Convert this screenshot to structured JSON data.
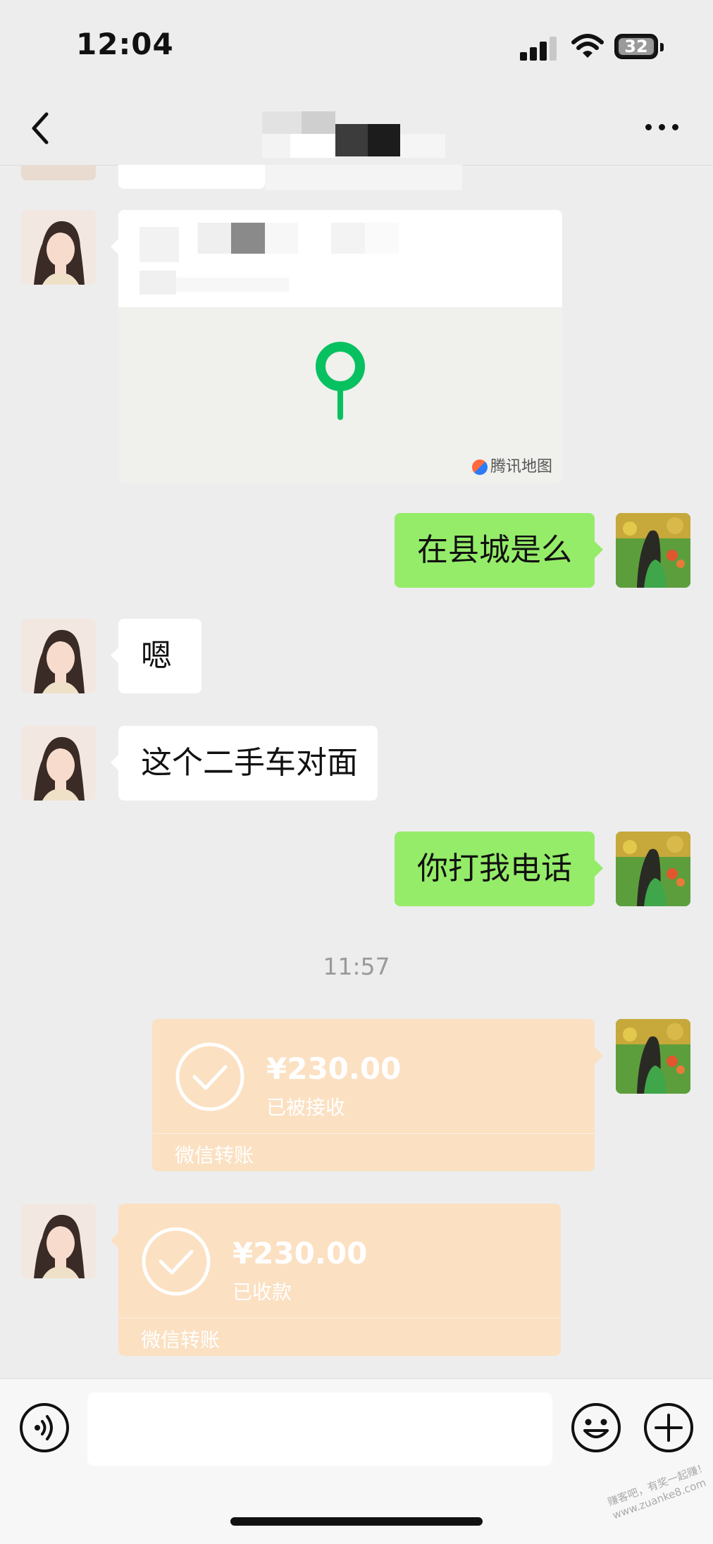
{
  "status_bar": {
    "time": "12:04",
    "battery": "32"
  },
  "header": {
    "title": "第"
  },
  "location": {
    "map_credit": "腾讯地图"
  },
  "messages": {
    "m1": "在县城是么",
    "m2": "嗯",
    "m3": "这个二手车对面",
    "m4": "你打我电话"
  },
  "timestamp": "11:57",
  "transfer_sent": {
    "amount": "¥230.00",
    "status": "已被接收",
    "label": "微信转账"
  },
  "transfer_received": {
    "amount": "¥230.00",
    "status": "已收款",
    "label": "微信转账"
  },
  "input": {
    "placeholder": ""
  },
  "watermark": {
    "line1": "赚客吧，有奖一起赚！",
    "line2": "www.zuanke8.com"
  },
  "colors": {
    "green_bubble": "#95ec69",
    "transfer_bg": "#fbe0c2",
    "pin": "#07c160"
  }
}
